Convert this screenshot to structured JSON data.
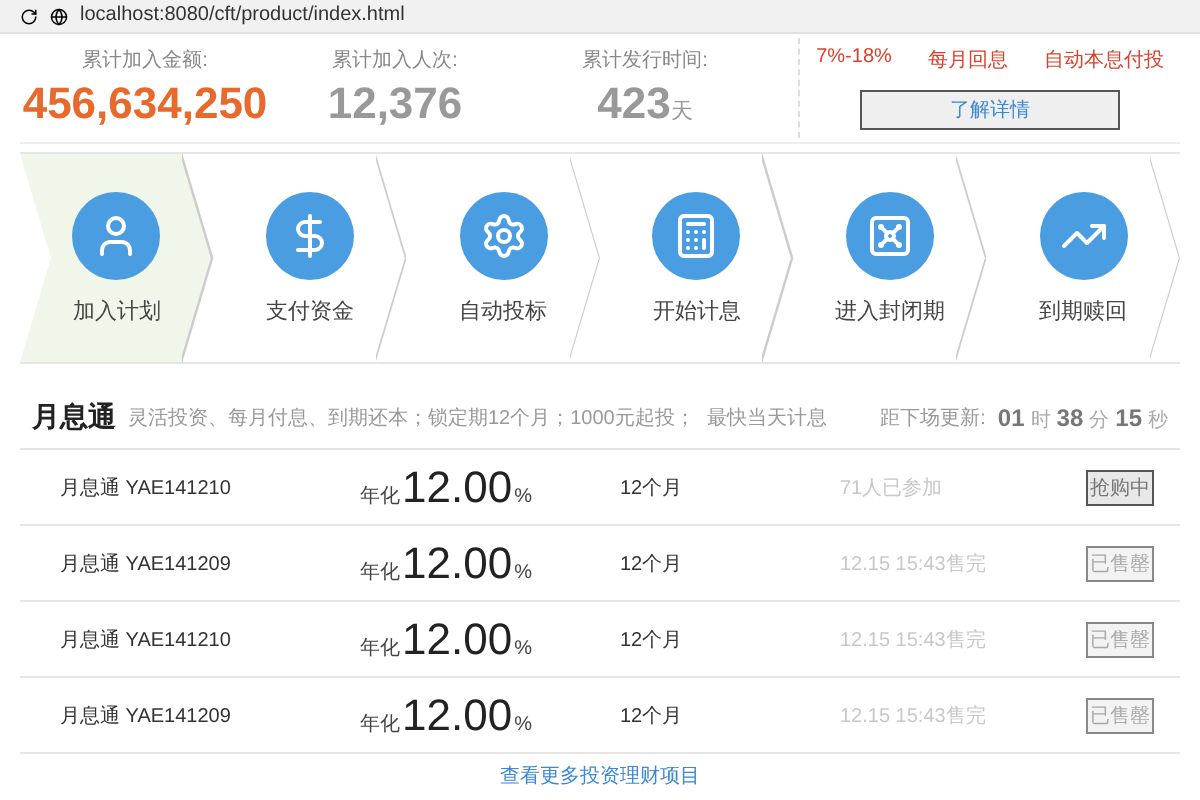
{
  "address_bar": {
    "url": "localhost:8080/cft/product/index.html"
  },
  "stats": [
    {
      "label": "累计加入金额:",
      "value": "456,634,250",
      "highlight": true
    },
    {
      "label": "累计加入人次:",
      "value": "12,376",
      "highlight": false
    },
    {
      "label": "累计发行时间:",
      "value": "423",
      "unit": "天",
      "highlight": false
    }
  ],
  "features": {
    "tags": [
      "7%-18%",
      "每月回息",
      "自动本息付投"
    ],
    "button": "了解详情"
  },
  "steps": [
    {
      "label": "加入计划",
      "selected": true
    },
    {
      "label": "支付资金",
      "selected": false
    },
    {
      "label": "自动投标",
      "selected": false
    },
    {
      "label": "开始计息",
      "selected": false
    },
    {
      "label": "进入封闭期",
      "selected": false
    },
    {
      "label": "到期赎回",
      "selected": false
    }
  ],
  "product": {
    "title": "月息通",
    "subtitle": "灵活投资、每月付息、到期还本；锁定期12个月；1000元起投；",
    "note": "最快当天计息",
    "countdown_label": "距下场更新:",
    "countdown": [
      {
        "value": "01",
        "unit": "时"
      },
      {
        "value": "38",
        "unit": "分"
      },
      {
        "value": "15",
        "unit": "秒"
      }
    ]
  },
  "rows": [
    {
      "name": "月息通 YAE141210",
      "rate_prefix": "年化",
      "rate": "12.00",
      "rate_unit": "%",
      "term": "12个月",
      "status": "71人已参加",
      "button": "抢购中",
      "sold_out": false
    },
    {
      "name": "月息通 YAE141209",
      "rate_prefix": "年化",
      "rate": "12.00",
      "rate_unit": "%",
      "term": "12个月",
      "status": "12.15 15:43售完",
      "button": "已售罄",
      "sold_out": true
    },
    {
      "name": "月息通 YAE141210",
      "rate_prefix": "年化",
      "rate": "12.00",
      "rate_unit": "%",
      "term": "12个月",
      "status": "12.15 15:43售完",
      "button": "已售罄",
      "sold_out": true
    },
    {
      "name": "月息通 YAE141209",
      "rate_prefix": "年化",
      "rate": "12.00",
      "rate_unit": "%",
      "term": "12个月",
      "status": "12.15 15:43售完",
      "button": "已售罄",
      "sold_out": true
    }
  ],
  "more_link": "查看更多投资理财项目"
}
